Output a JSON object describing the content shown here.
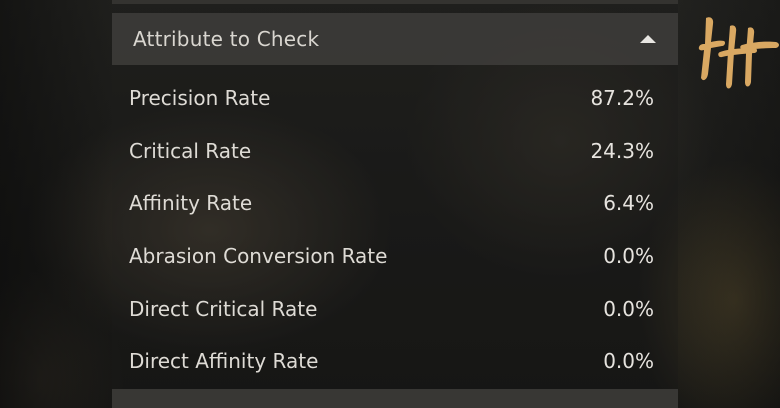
{
  "section": {
    "title": "Attribute to Check",
    "expanded": true
  },
  "attributes": [
    {
      "name": "Precision Rate",
      "value": "87.2%"
    },
    {
      "name": "Critical Rate",
      "value": "24.3%"
    },
    {
      "name": "Affinity Rate",
      "value": "6.4%"
    },
    {
      "name": "Abrasion Conversion Rate",
      "value": "0.0%"
    },
    {
      "name": "Direct Critical Rate",
      "value": "0.0%"
    },
    {
      "name": "Direct Affinity Rate",
      "value": "0.0%"
    }
  ],
  "next_section": {
    "title": ""
  },
  "logo": {
    "icon": "brush-stroke-logo-icon",
    "color": "#d9a862"
  },
  "colors": {
    "header_bg": "#403e3c",
    "text": "#dedbd5"
  }
}
